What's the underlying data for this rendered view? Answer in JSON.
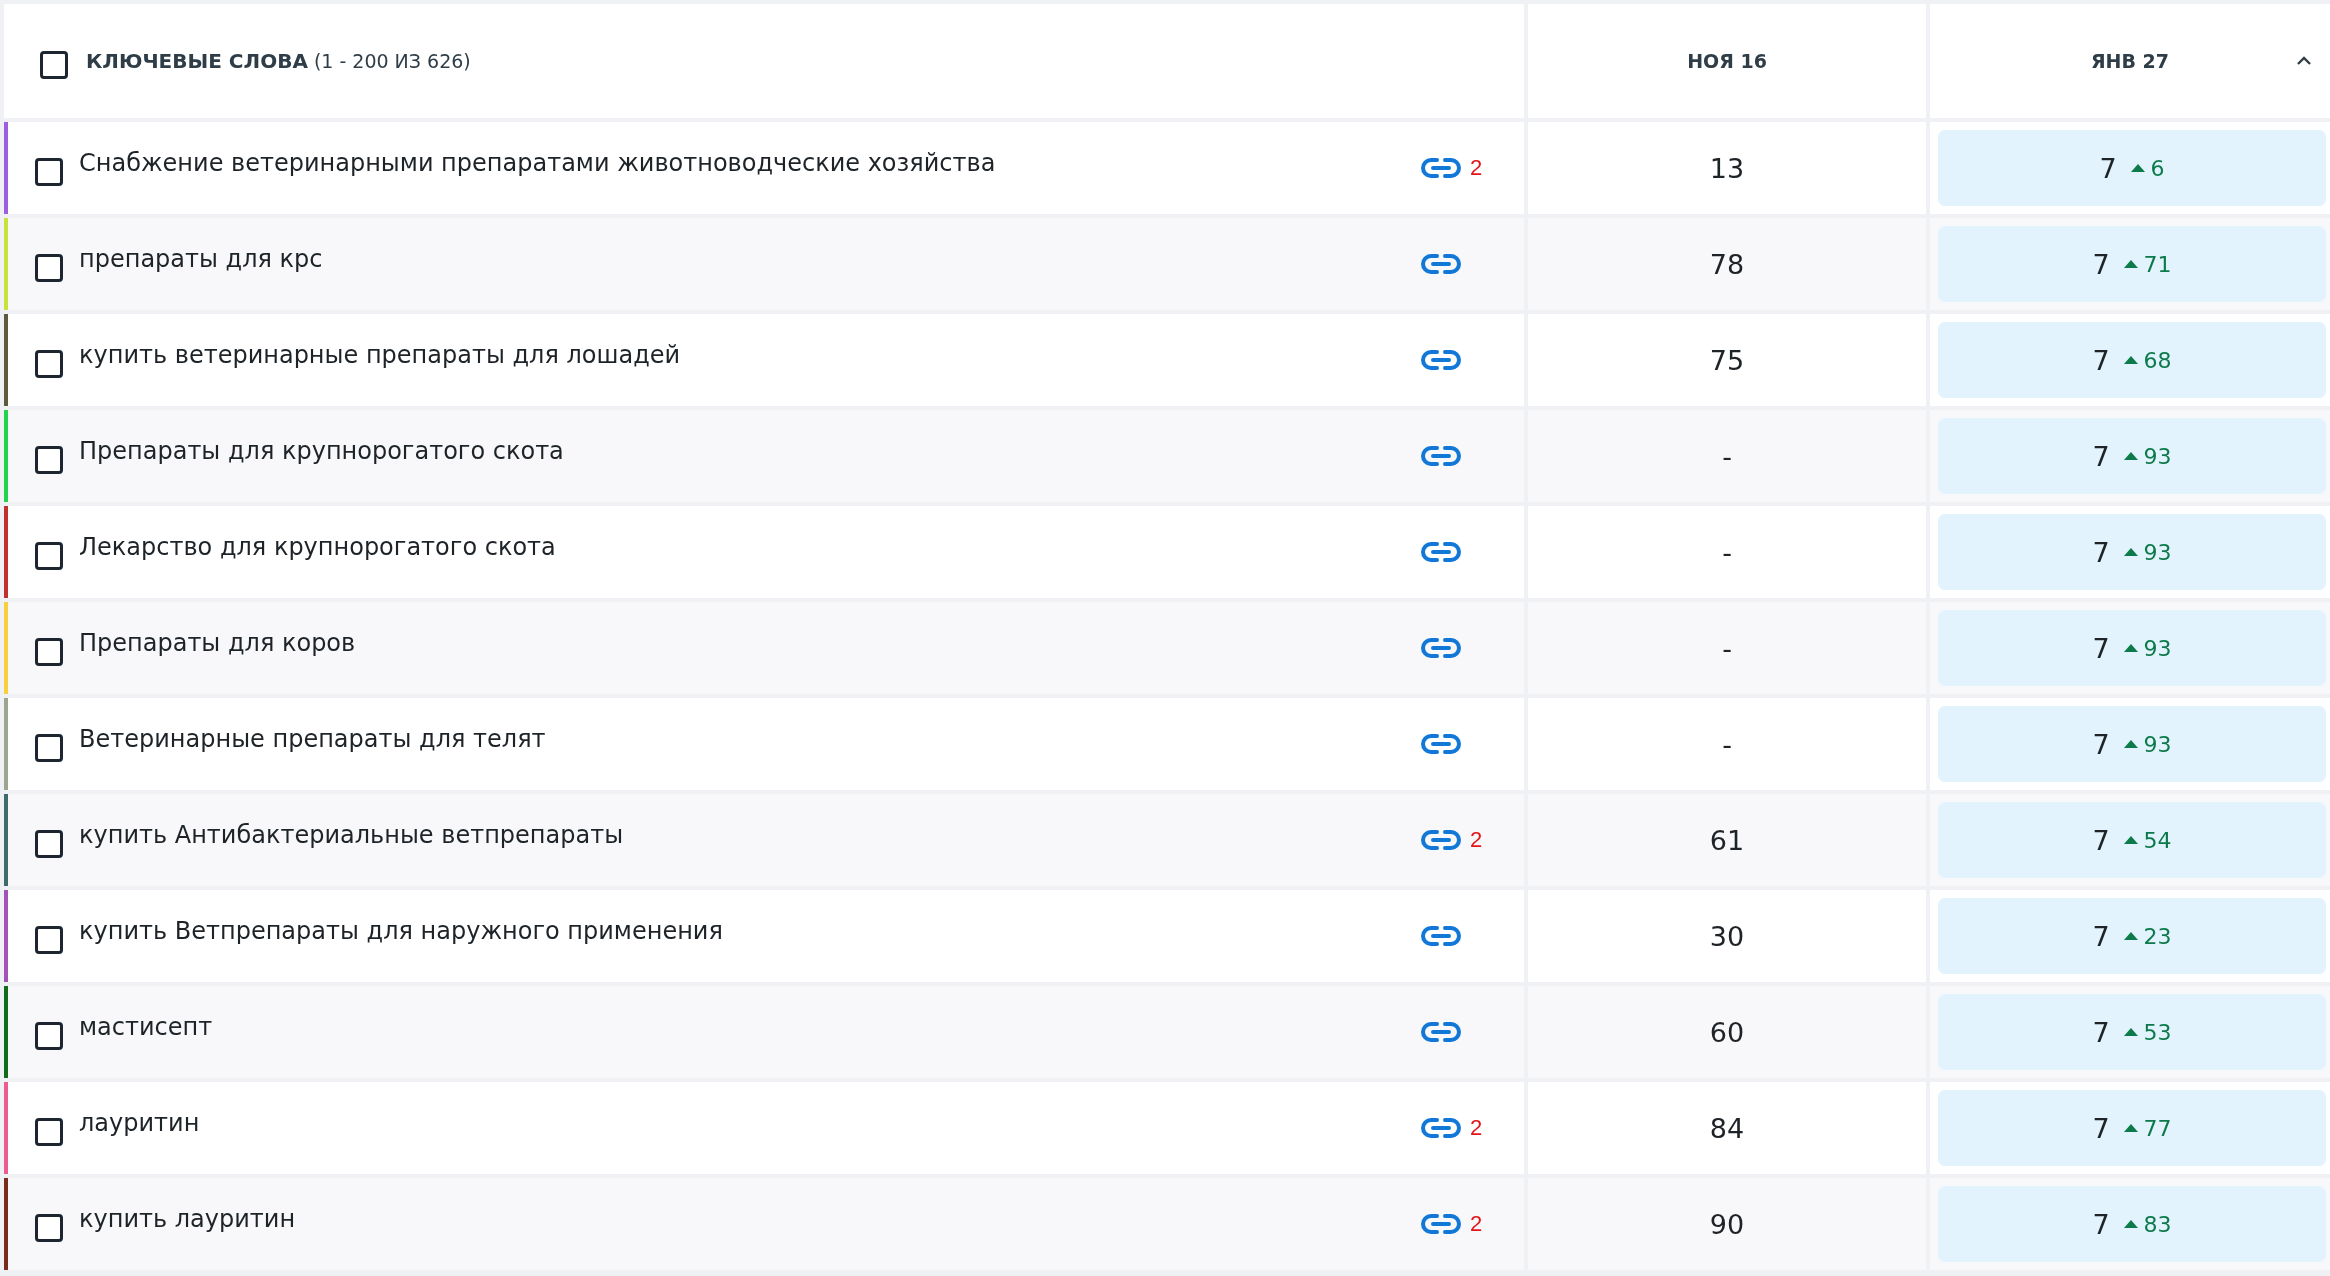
{
  "header": {
    "checked": false,
    "title": "КЛЮЧЕВЫЕ СЛОВА",
    "range": "(1 - 200 ИЗ 626)",
    "columns": [
      "НОЯ 16",
      "ЯНВ 27"
    ],
    "sorted_ascending": true
  },
  "rows": [
    {
      "keyword": "Снабжение ветеринарными препаратами животноводческие хозяйства",
      "color": "#9b5fe0",
      "checked": false,
      "links": "2",
      "prev": "13",
      "rank": "7",
      "rising": true,
      "change": "6"
    },
    {
      "keyword": "препараты для крс",
      "color": "#c8e23a",
      "checked": false,
      "prev": "78",
      "rank": "7",
      "rising": true,
      "change": "71"
    },
    {
      "keyword": "купить ветеринарные препараты для лошадей",
      "color": "#5e5a3c",
      "checked": false,
      "prev": "75",
      "rank": "7",
      "rising": true,
      "change": "68"
    },
    {
      "keyword": "Препараты для крупнорогатого скота",
      "color": "#22d44c",
      "checked": false,
      "prev": "-",
      "rank": "7",
      "rising": true,
      "change": "93"
    },
    {
      "keyword": "Лекарство для крупнорогатого скота",
      "color": "#c2302e",
      "checked": false,
      "prev": "-",
      "rank": "7",
      "rising": true,
      "change": "93"
    },
    {
      "keyword": "Препараты для коров",
      "color": "#f8d03e",
      "checked": false,
      "prev": "-",
      "rank": "7",
      "rising": true,
      "change": "93"
    },
    {
      "keyword": "Ветеринарные препараты для телят",
      "color": "#9ba690",
      "checked": false,
      "prev": "-",
      "rank": "7",
      "rising": true,
      "change": "93"
    },
    {
      "keyword": "купить Антибактериальные ветпрепараты",
      "color": "#3e6c6c",
      "checked": false,
      "links": "2",
      "prev": "61",
      "rank": "7",
      "rising": true,
      "change": "54"
    },
    {
      "keyword": "купить Ветпрепараты для наружного применения",
      "color": "#a252ba",
      "checked": false,
      "prev": "30",
      "rank": "7",
      "rising": true,
      "change": "23"
    },
    {
      "keyword": "мастисепт",
      "color": "#0e6c1c",
      "checked": false,
      "prev": "60",
      "rank": "7",
      "rising": true,
      "change": "53"
    },
    {
      "keyword": "лауритин",
      "color": "#ec5c90",
      "checked": false,
      "links": "2",
      "prev": "84",
      "rank": "7",
      "rising": true,
      "change": "77"
    },
    {
      "keyword": "купить лауритин",
      "color": "#7a2c1c",
      "checked": false,
      "links": "2",
      "prev": "90",
      "rank": "7",
      "rising": true,
      "change": "83"
    }
  ]
}
